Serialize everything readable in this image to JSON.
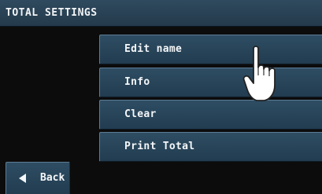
{
  "header": {
    "title": "TOTAL SETTINGS"
  },
  "menu": {
    "items": [
      {
        "label": "Edit name"
      },
      {
        "label": "Info"
      },
      {
        "label": "Clear"
      },
      {
        "label": "Print Total"
      }
    ]
  },
  "back_button": {
    "label": "Back",
    "icon": "left-arrow-icon"
  },
  "pointer": {
    "icon": "hand-pointer-icon"
  },
  "colors": {
    "header_bg": "#2a4456",
    "button_bg": "#284458",
    "text": "#f4f6f8",
    "background": "#0c0c0c"
  }
}
